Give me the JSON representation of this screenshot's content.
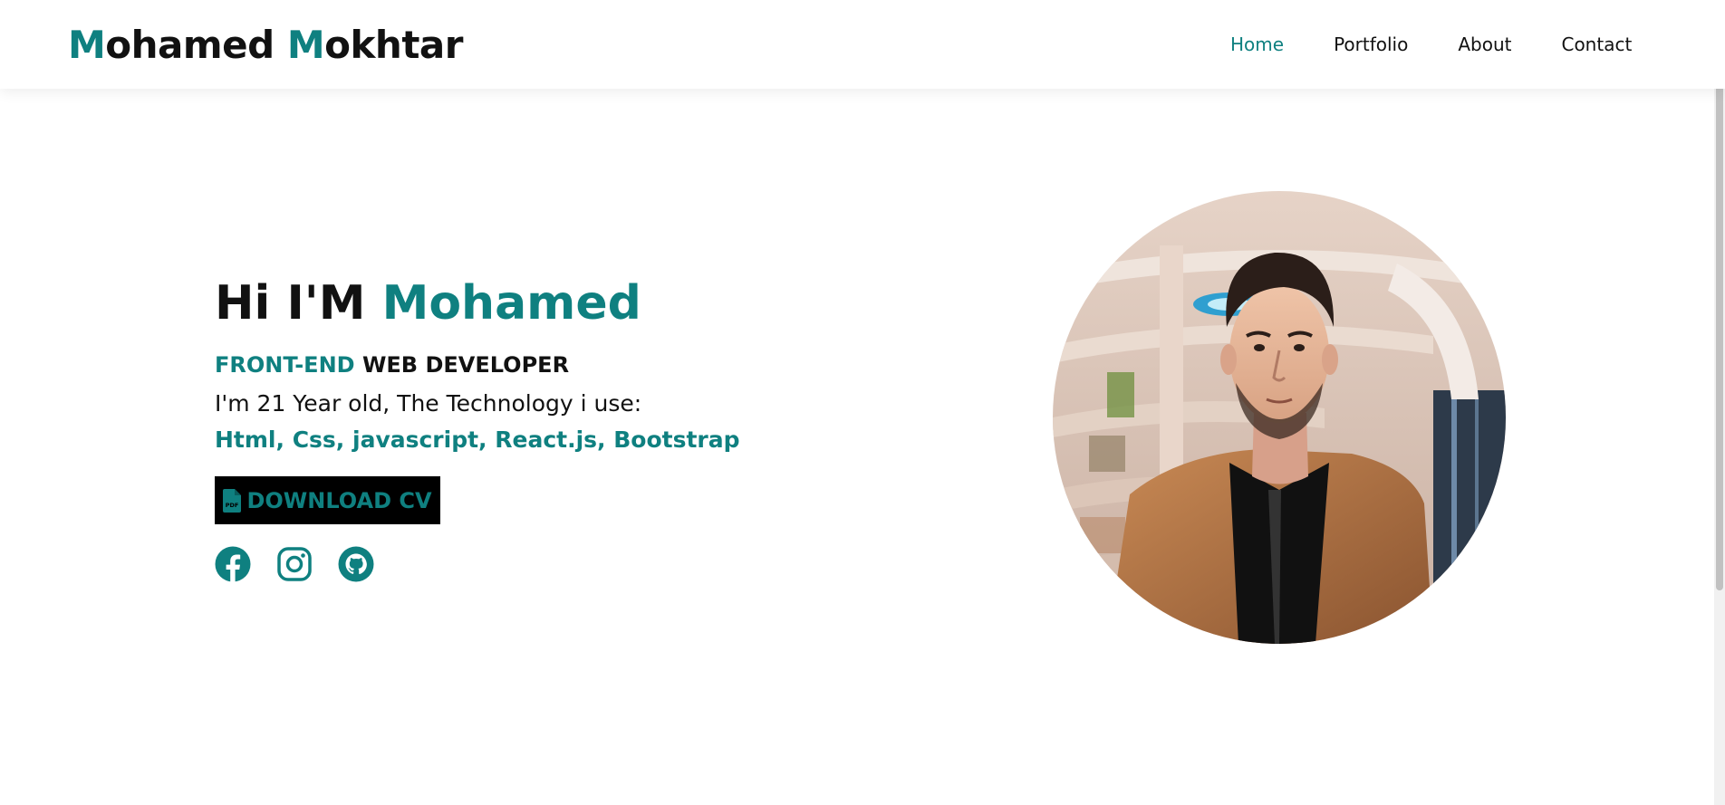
{
  "header": {
    "brand": {
      "first_initial": "M",
      "first_rest": "ohamed",
      "last_initial": "M",
      "last_rest": "okhtar"
    },
    "nav": [
      {
        "label": "Home",
        "active": true
      },
      {
        "label": "Portfolio",
        "active": false
      },
      {
        "label": "About",
        "active": false
      },
      {
        "label": "Contact",
        "active": false
      }
    ]
  },
  "hero": {
    "greeting": "Hi I'M",
    "name": "Mohamed",
    "role_accent": "FRONT-END",
    "role_rest": "WEB DEVELOPER",
    "about": "I'm 21 Year old, The Technology i use:",
    "technologies": "Html, Css, javascript, React.js, Bootstrap",
    "cv_button": "DOWNLOAD CV",
    "cv_icon": "file-pdf-icon",
    "socials": [
      {
        "name": "facebook",
        "icon": "facebook-icon"
      },
      {
        "name": "instagram",
        "icon": "instagram-icon"
      },
      {
        "name": "github",
        "icon": "github-icon"
      }
    ],
    "photo": "profile-photo"
  },
  "colors": {
    "accent": "#0f8080",
    "text": "#111111",
    "background": "#ffffff",
    "button_bg": "#000000"
  }
}
